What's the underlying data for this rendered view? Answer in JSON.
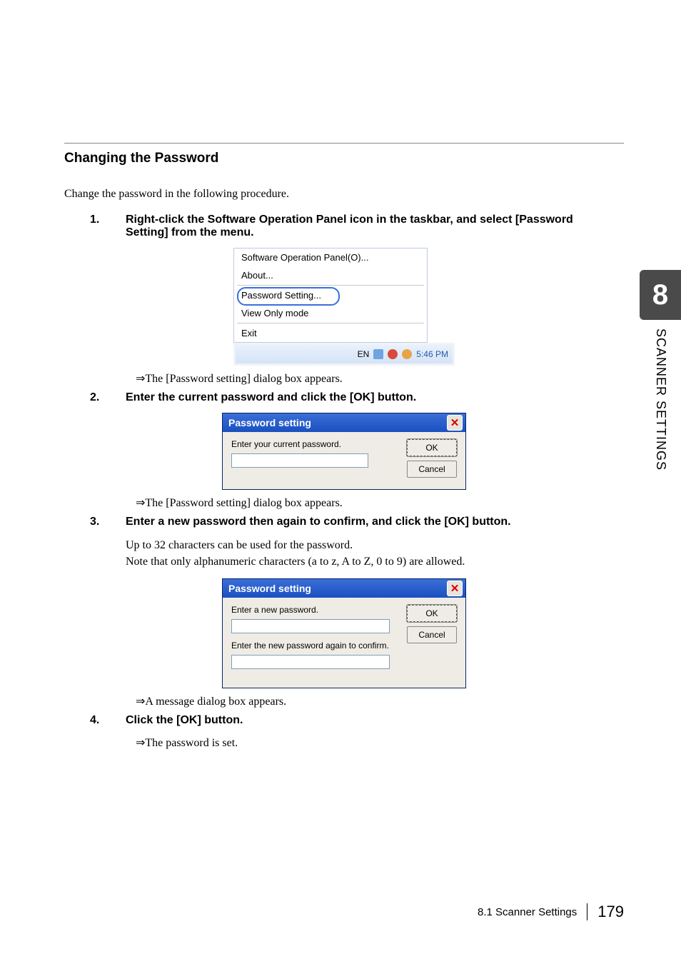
{
  "section_title": "Changing the Password",
  "intro": "Change the password in the following procedure.",
  "steps": [
    {
      "num": "1.",
      "text": "Right-click the Software Operation Panel icon in the taskbar, and select [Password Setting] from the menu.",
      "result": "⇒The [Password setting] dialog box appears."
    },
    {
      "num": "2.",
      "text": "Enter the current password and click the [OK] button.",
      "result": "⇒The [Password setting] dialog box appears."
    },
    {
      "num": "3.",
      "text": "Enter a new password then again to confirm, and click the [OK] button.",
      "body1": "Up to 32 characters can be used for the password.",
      "body2": "Note that only alphanumeric characters (a to z, A to Z, 0 to 9) are allowed.",
      "result": "⇒A message dialog box appears."
    },
    {
      "num": "4.",
      "text": "Click the [OK] button.",
      "result": "⇒The password is set."
    }
  ],
  "ctx_menu": {
    "item1": "Software Operation Panel(O)...",
    "item2": "About...",
    "item3": "Password Setting...",
    "item4": "View Only mode",
    "item5": "Exit",
    "lang": "EN",
    "clock": "5:46 PM"
  },
  "dialog1": {
    "title": "Password setting",
    "label": "Enter your current password.",
    "ok": "OK",
    "cancel": "Cancel"
  },
  "dialog2": {
    "title": "Password setting",
    "label1": "Enter a new password.",
    "label2": "Enter the new password again to confirm.",
    "ok": "OK",
    "cancel": "Cancel"
  },
  "side": {
    "chapter": "8",
    "label": "SCANNER SETTINGS"
  },
  "footer": {
    "section": "8.1 Scanner Settings",
    "page": "179"
  }
}
